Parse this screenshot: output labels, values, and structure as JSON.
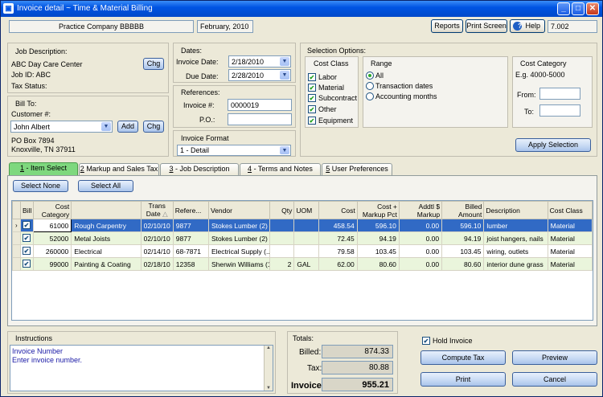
{
  "window": {
    "title": "Invoice detail ~ Time & Material Billing"
  },
  "header": {
    "company": "Practice Company BBBBB",
    "period": "February, 2010",
    "reports": "Reports",
    "print_screen": "Print Screen",
    "help": "Help",
    "version": "7.002"
  },
  "job": {
    "heading": "Job Description:",
    "name": "ABC Day Care Center",
    "job_id": "Job ID:  ABC",
    "tax_status": "Tax Status:",
    "chg": "Chg"
  },
  "bill_to": {
    "heading": "Bill To:",
    "customer_label": "Customer #:",
    "customer": "John Albert",
    "add": "Add",
    "chg": "Chg",
    "addr1": "PO Box 7894",
    "addr2": "Knoxville, TN  37911"
  },
  "dates": {
    "heading": "Dates:",
    "invoice_label": "Invoice Date:",
    "invoice_date": "2/18/2010",
    "due_label": "Due Date:",
    "due_date": "2/28/2010"
  },
  "references": {
    "heading": "References:",
    "invoice_label": "Invoice #:",
    "invoice_no": "0000019",
    "po_label": "P.O.:",
    "po": ""
  },
  "format": {
    "heading": "Invoice Format",
    "value": "1 - Detail"
  },
  "selection": {
    "heading": "Selection Options:",
    "cost_class": {
      "heading": "Cost Class",
      "items": [
        "Labor",
        "Material",
        "Subcontract",
        "Other",
        "Equipment"
      ]
    },
    "range": {
      "heading": "Range",
      "options": [
        "All",
        "Transaction dates",
        "Accounting months"
      ]
    },
    "cost_category": {
      "heading": "Cost Category",
      "example": "E.g. 4000-5000",
      "from": "From:",
      "to": "To:"
    },
    "apply": "Apply Selection"
  },
  "tabs": [
    {
      "num": "1",
      "label": " - Item Select"
    },
    {
      "num": "2",
      "label": " Markup and Sales Tax"
    },
    {
      "num": "3",
      "label": " - Job Description"
    },
    {
      "num": "4",
      "label": " - Terms and Notes"
    },
    {
      "num": "5",
      "label": " User Preferences"
    }
  ],
  "grid_buttons": {
    "select_none": "Select None",
    "select_all": "Select All"
  },
  "columns": [
    "Bill",
    "Cost Category",
    "",
    "Trans Date",
    "Refere...",
    "Vendor",
    "Qty",
    "UOM",
    "Cost",
    "Cost + Markup Pct",
    "Addtl $ Markup",
    "Billed Amount",
    "Description",
    "Cost Class"
  ],
  "rows": [
    {
      "cat": "61000",
      "name": "Rough Carpentry",
      "date": "02/10/10",
      "ref": "9877",
      "vendor": "Stokes Lumber (2)",
      "qty": "",
      "uom": "",
      "cost": "458.54",
      "markup": "596.10",
      "addtl": "0.00",
      "billed": "596.10",
      "desc": "lumber",
      "cls": "Material"
    },
    {
      "cat": "52000",
      "name": "Metal Joists",
      "date": "02/10/10",
      "ref": "9877",
      "vendor": "Stokes Lumber (2)",
      "qty": "",
      "uom": "",
      "cost": "72.45",
      "markup": "94.19",
      "addtl": "0.00",
      "billed": "94.19",
      "desc": "joist hangers, nails",
      "cls": "Material"
    },
    {
      "cat": "260000",
      "name": "Electrical",
      "date": "02/14/10",
      "ref": "68-7871",
      "vendor": "Electrical Supply (...",
      "qty": "",
      "uom": "",
      "cost": "79.58",
      "markup": "103.45",
      "addtl": "0.00",
      "billed": "103.45",
      "desc": "wiring, outlets",
      "cls": "Material"
    },
    {
      "cat": "99000",
      "name": "Painting & Coating",
      "date": "02/18/10",
      "ref": "12358",
      "vendor": "Sherwin Williams (1)",
      "qty": "2",
      "uom": "GAL",
      "cost": "62.00",
      "markup": "80.60",
      "addtl": "0.00",
      "billed": "80.60",
      "desc": "interior dune grass",
      "cls": "Material"
    }
  ],
  "instructions": {
    "heading": "Instructions",
    "line1": "Invoice Number",
    "line2": "Enter invoice number."
  },
  "totals": {
    "heading": "Totals:",
    "billed_label": "Billed:",
    "billed": "874.33",
    "tax_label": "Tax:",
    "tax": "80.88",
    "invoice_label": "Invoice:",
    "invoice": "955.21"
  },
  "actions": {
    "hold": "Hold Invoice",
    "compute_tax": "Compute Tax",
    "preview": "Preview",
    "print": "Print",
    "cancel": "Cancel"
  }
}
